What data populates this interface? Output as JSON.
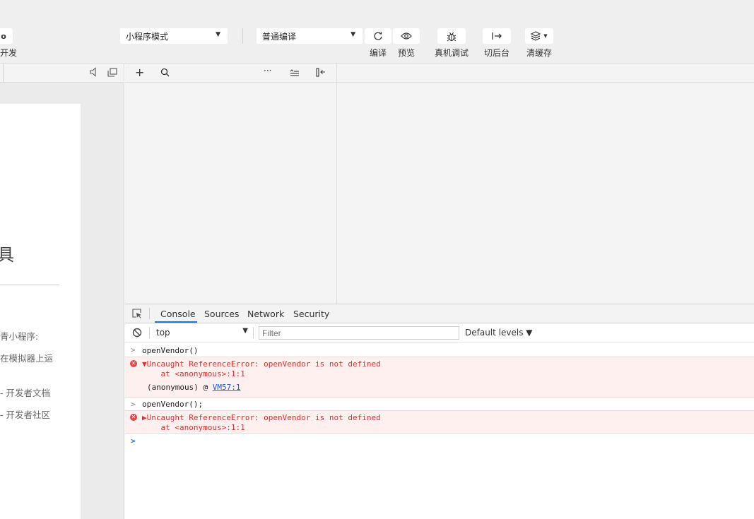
{
  "toolbar": {
    "partial_left_icon": "o",
    "partial_left_label": "开发",
    "mode_select": "小程序模式",
    "compile_select": "普通编译",
    "buttons": [
      {
        "label": "编译",
        "icon": "refresh-icon"
      },
      {
        "label": "预览",
        "icon": "eye-icon"
      },
      {
        "label": "真机调试",
        "icon": "bug-icon"
      },
      {
        "label": "切后台",
        "icon": "switch-background-icon"
      },
      {
        "label": "清缓存",
        "icon": "layers-icon"
      }
    ]
  },
  "simulator": {
    "partial_title": "具",
    "lines": [
      "青小程序:",
      "在模拟器上运",
      "- 开发者文档",
      "- 开发者社区"
    ]
  },
  "devtools": {
    "tabs": [
      "Console",
      "Sources",
      "Network",
      "Security"
    ],
    "context": "top",
    "filter_placeholder": "Filter",
    "levels": "Default levels ▼",
    "entries": [
      {
        "input": "openVendor()"
      },
      {
        "error": "▼Uncaught ReferenceError: openVendor is not defined",
        "at": "    at <anonymous>:1:1",
        "stack_prefix": "(anonymous) @ ",
        "stack_link": "VM57:1"
      },
      {
        "input": "openVendor();"
      },
      {
        "error": "▶Uncaught ReferenceError: openVendor is not defined",
        "at": "    at <anonymous>:1:1"
      }
    ]
  },
  "colors": {
    "accent": "#1a73e8",
    "error": "#e0302d",
    "error_bg": "#fff0f0"
  }
}
